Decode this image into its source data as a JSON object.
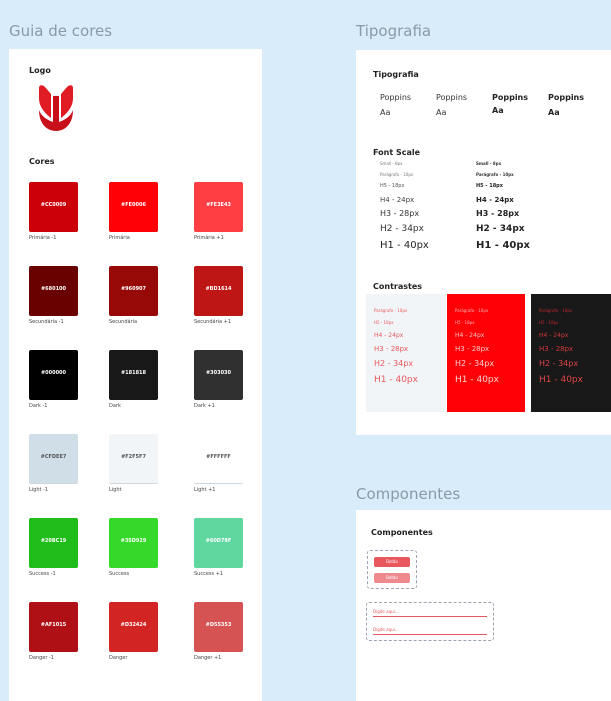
{
  "frames": {
    "left_title": "Guia de cores",
    "typo_title": "Tipografia",
    "comp_title": "Componentes"
  },
  "left": {
    "logo_heading": "Logo",
    "colors_heading": "Cores",
    "swatches": [
      {
        "code": "#CC0009",
        "label": "Primária -1",
        "color": "#cc0009"
      },
      {
        "code": "#FE0006",
        "label": "Primária",
        "color": "#fe0006"
      },
      {
        "code": "#FE3E43",
        "label": "Primária +1",
        "color": "#fe3e43"
      },
      {
        "code": "#680100",
        "label": "Secundária -1",
        "color": "#680100"
      },
      {
        "code": "#960907",
        "label": "Secundária",
        "color": "#960907"
      },
      {
        "code": "#BD1614",
        "label": "Secundária +1",
        "color": "#bd1614"
      },
      {
        "code": "#000000",
        "label": "Dark -1",
        "color": "#000000"
      },
      {
        "code": "#181818",
        "label": "Dark",
        "color": "#181818"
      },
      {
        "code": "#303030",
        "label": "Dark +1",
        "color": "#303030"
      },
      {
        "code": "#CFDEE7",
        "label": "Light -1",
        "color": "#cfdee7"
      },
      {
        "code": "#F2F5F7",
        "label": "Light",
        "color": "#f2f5f7"
      },
      {
        "code": "#FFFFFF",
        "label": "Light +1",
        "color": "#ffffff"
      },
      {
        "code": "#20BC19",
        "label": "Success -1",
        "color": "#20bc19"
      },
      {
        "code": "#35D929",
        "label": "Success",
        "color": "#35d929"
      },
      {
        "code": "#60D79F",
        "label": "Success +1",
        "color": "#60d79f"
      },
      {
        "code": "#AF1015",
        "label": "Danger -1",
        "color": "#af1015"
      },
      {
        "code": "#D32424",
        "label": "Danger",
        "color": "#d32424"
      },
      {
        "code": "#D55353",
        "label": "Danger +1",
        "color": "#d55353"
      }
    ]
  },
  "typography": {
    "heading": "Tipografia",
    "samples": [
      {
        "name": "Poppins",
        "glyph": "Aa"
      },
      {
        "name": "Poppins",
        "glyph": "Aa"
      },
      {
        "name": "Poppins",
        "glyph": "Aa"
      },
      {
        "name": "Poppins",
        "glyph": "Aa"
      }
    ],
    "font_scale_heading": "Font Scale",
    "scale_regular": [
      "Small - 8px",
      "Parágrafo - 10px",
      "H5 - 18px",
      "H4 - 24px",
      "H3 - 28px",
      "H2 - 34px",
      "H1 - 40px"
    ],
    "scale_bold": [
      "Small - 8px",
      "Parágrafo - 10px",
      "H5 - 18px",
      "H4 - 24px",
      "H3 - 28px",
      "H2 - 34px",
      "H1 - 40px"
    ],
    "contrasts_heading": "Contrastes",
    "contrast_lines": [
      "Parágrafo - 10px",
      "H5 - 18px",
      "H4 - 24px",
      "H3 - 28px",
      "H2 - 34px",
      "H1 - 40px"
    ]
  },
  "components": {
    "heading": "Componentes",
    "button1": "Botão",
    "button2": "Botão",
    "input1_placeholder": "Digite aqui...",
    "input2_placeholder": "Digite aqui..."
  }
}
